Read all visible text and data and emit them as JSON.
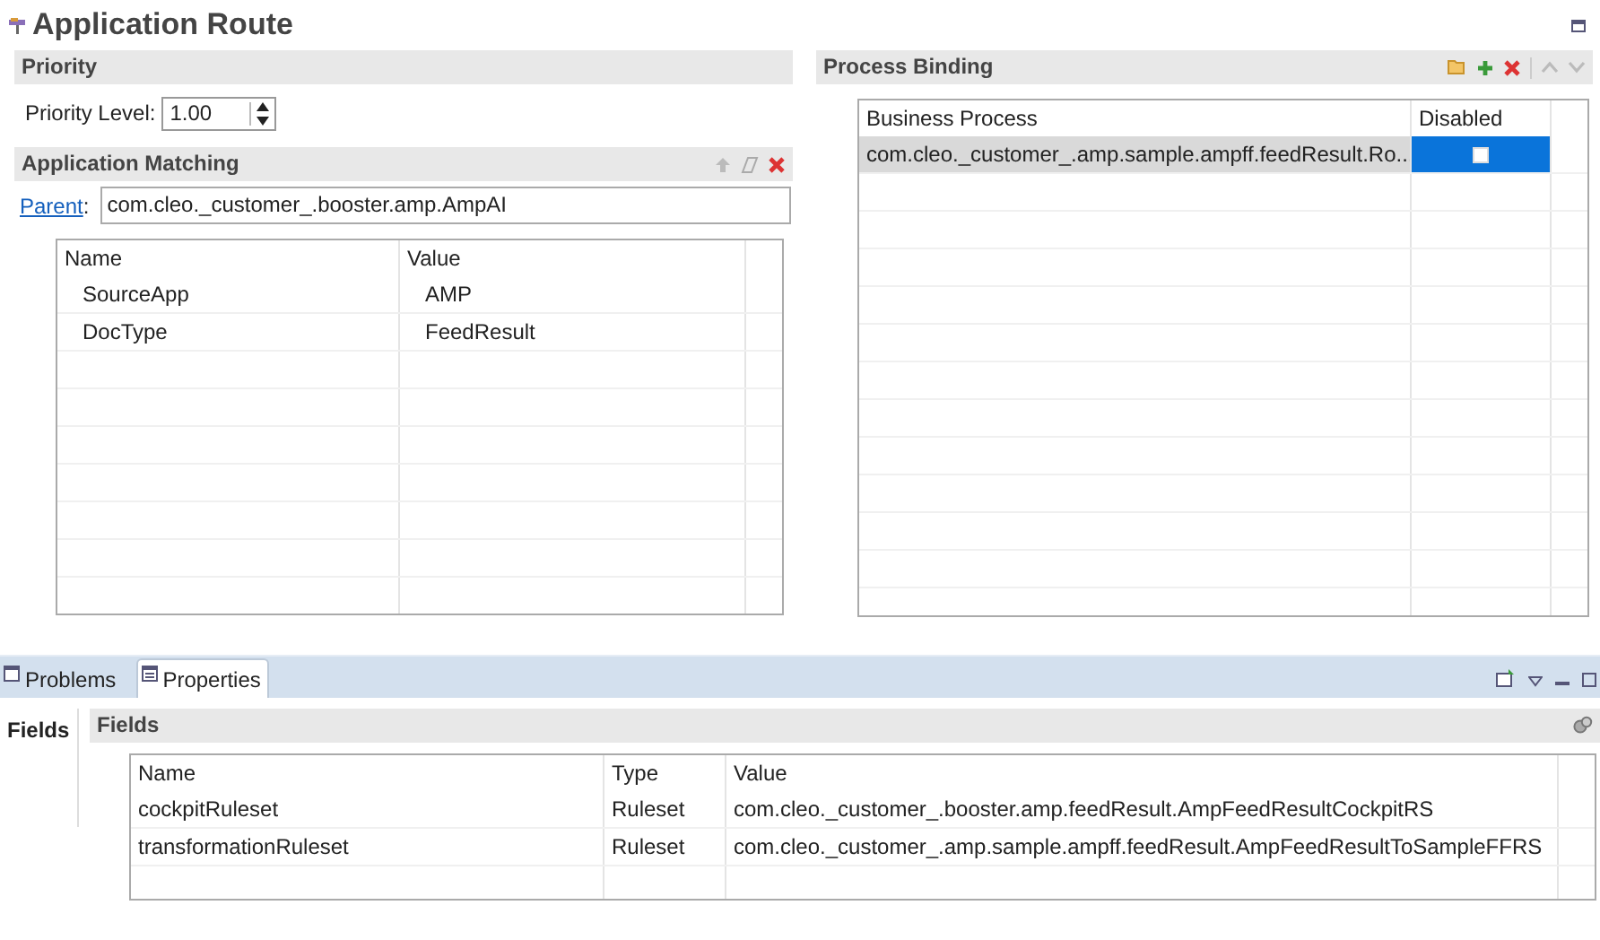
{
  "title": "Application Route",
  "priority": {
    "header": "Priority",
    "label": "Priority Level:",
    "value": "1.00"
  },
  "matching": {
    "header": "Application Matching",
    "parent_link": "Parent",
    "parent_colon": ":",
    "parent_value": "com.cleo._customer_.booster.amp.AmpAI",
    "columns": [
      "Name",
      "Value"
    ],
    "rows": [
      {
        "name": "SourceApp",
        "value": "AMP"
      },
      {
        "name": "DocType",
        "value": "FeedResult"
      }
    ]
  },
  "process_binding": {
    "header": "Process Binding",
    "columns": [
      "Business Process",
      "Disabled"
    ],
    "rows": [
      {
        "process": "com.cleo._customer_.amp.sample.ampff.feedResult.Ro...",
        "disabled": false,
        "selected": true
      }
    ]
  },
  "bottom_tabs": [
    {
      "label": "Problems",
      "selected": false
    },
    {
      "label": "Properties",
      "selected": true
    }
  ],
  "side_tab": "Fields",
  "fields": {
    "header": "Fields",
    "columns": [
      "Name",
      "Type",
      "Value"
    ],
    "rows": [
      {
        "name": "cockpitRuleset",
        "type": "Ruleset",
        "value": "com.cleo._customer_.booster.amp.feedResult.AmpFeedResultCockpitRS"
      },
      {
        "name": "transformationRuleset",
        "type": "Ruleset",
        "value": "com.cleo._customer_.amp.sample.ampff.feedResult.AmpFeedResultToSampleFFRS"
      }
    ]
  }
}
